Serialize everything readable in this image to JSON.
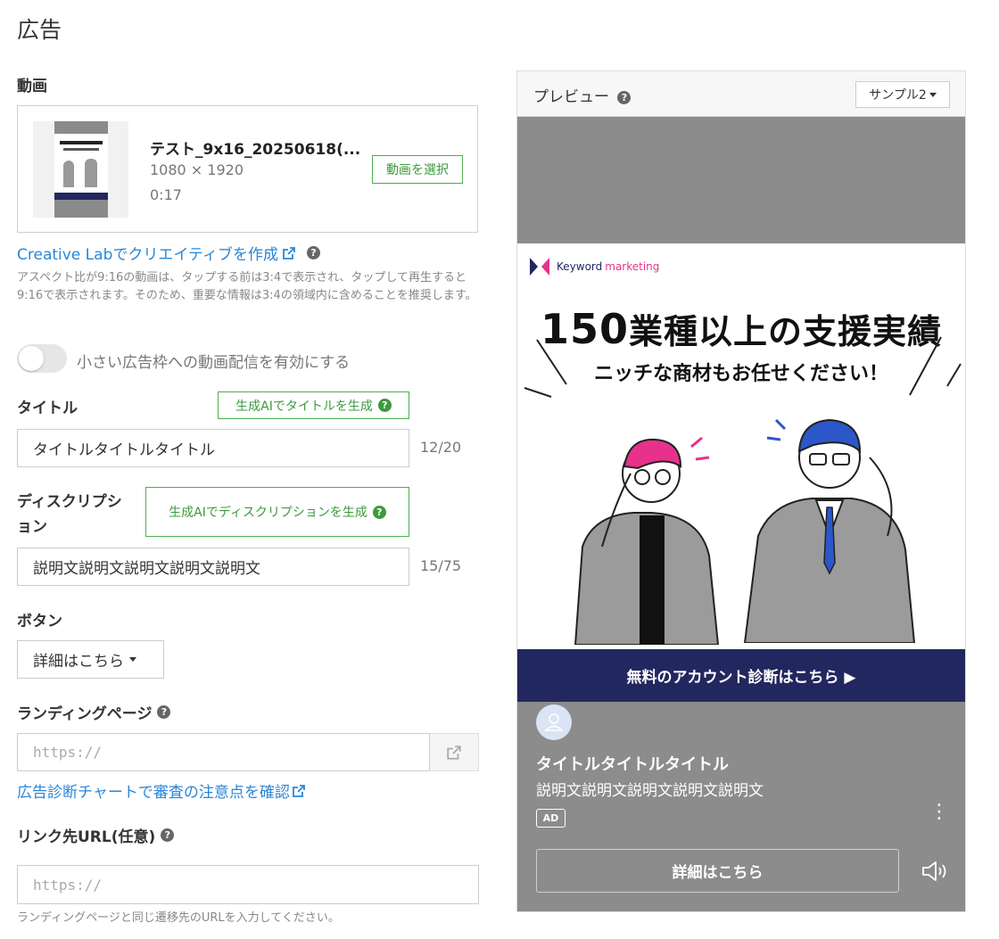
{
  "page": {
    "title": "広告"
  },
  "video": {
    "section_label": "動画",
    "file_name": "テスト_9x16_20250618(...",
    "resolution": "1080 × 1920",
    "duration": "0:17",
    "select_button": "動画を選択",
    "creative_lab_link": "Creative Labでクリエイティブを作成",
    "aspect_note": "アスペクト比が9:16の動画は、タップする前は3:4で表示され、タップして再生すると9:16で表示されます。そのため、重要な情報は3:4の領域内に含めることを推奨します。",
    "small_slot_toggle_label": "小さい広告枠への動画配信を有効にする"
  },
  "title_field": {
    "label": "タイトル",
    "ai_button": "生成AIでタイトルを生成",
    "value": "タイトルタイトルタイトル",
    "counter": "12/20"
  },
  "description_field": {
    "label_line1": "ディスクリプシ",
    "label_line2": "ョン",
    "ai_button": "生成AIでディスクリプションを生成",
    "value": "説明文説明文説明文説明文説明文",
    "counter": "15/75"
  },
  "button_field": {
    "label": "ボタン",
    "selected": "詳細はこちら"
  },
  "landing_page": {
    "label": "ランディングページ",
    "placeholder": "https://",
    "review_link": "広告診断チャートで審査の注意点を確認"
  },
  "link_url": {
    "label": "リンク先URL(任意)",
    "placeholder": "https://",
    "note": "ランディングページと同じ遷移先のURLを入力してください。"
  },
  "preview": {
    "title": "プレビュー",
    "sample_select": "サンプル2",
    "brand_keyword": "Keyword",
    "brand_marketing": "marketing",
    "headline_number": "150",
    "headline_rest": "業種以上の支援実績",
    "subline": "ニッチな商材もお任せください！",
    "cta_band": "無料のアカウント診断はこちら ▶",
    "ad_title": "タイトルタイトルタイトル",
    "ad_description": "説明文説明文説明文説明文説明文",
    "ad_badge": "AD",
    "cta_button": "詳細はこちら"
  },
  "colors": {
    "accent_green": "#3c9a3c",
    "link_blue": "#2a86d8",
    "brand_navy": "#23275f",
    "brand_pink": "#e8318a",
    "brand_blue": "#2b57c9"
  }
}
